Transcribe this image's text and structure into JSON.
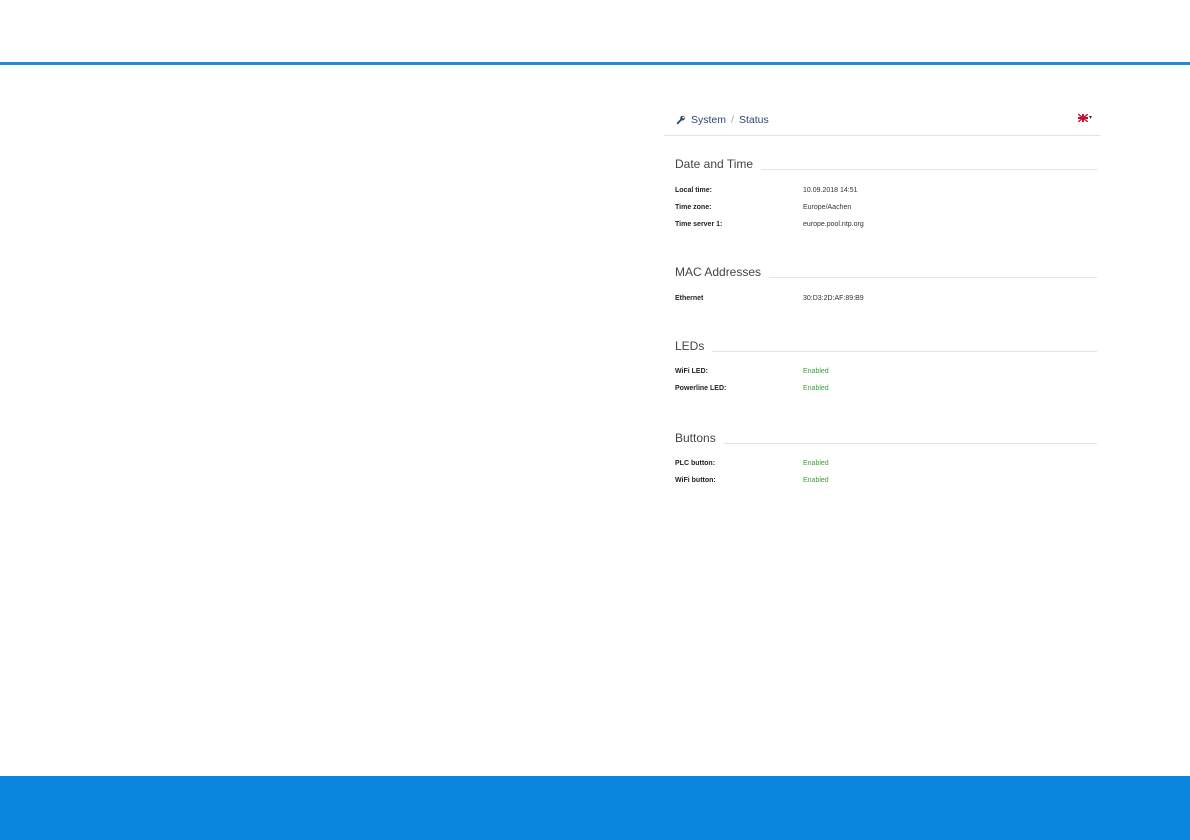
{
  "breadcrumb": {
    "parent": "System",
    "separator": "/",
    "current": "Status",
    "icon": "wrench-icon"
  },
  "language": {
    "icon": "uk-flag-icon",
    "caret": "▾"
  },
  "sections": {
    "datetime": {
      "title": "Date and Time",
      "rows": [
        {
          "label": "Local time:",
          "value": "10.09.2018 14:51"
        },
        {
          "label": "Time zone:",
          "value": "Europe/Aachen"
        },
        {
          "label": "Time server 1:",
          "value": "europe.pool.ntp.org"
        }
      ]
    },
    "mac": {
      "title": "MAC Addresses",
      "rows": [
        {
          "label": "Ethernet",
          "value": "30:D3:2D:AF:89:B9"
        }
      ]
    },
    "leds": {
      "title": "LEDs",
      "rows": [
        {
          "label": "WiFi LED:",
          "value": "Enabled"
        },
        {
          "label": "Powerline LED:",
          "value": "Enabled"
        }
      ]
    },
    "buttons": {
      "title": "Buttons",
      "rows": [
        {
          "label": "PLC button:",
          "value": "Enabled"
        },
        {
          "label": "WiFi button:",
          "value": "Enabled"
        }
      ]
    }
  },
  "colors": {
    "accent": "#1f8ad6",
    "footer": "#0a86df",
    "enabled": "#3aa23a"
  }
}
